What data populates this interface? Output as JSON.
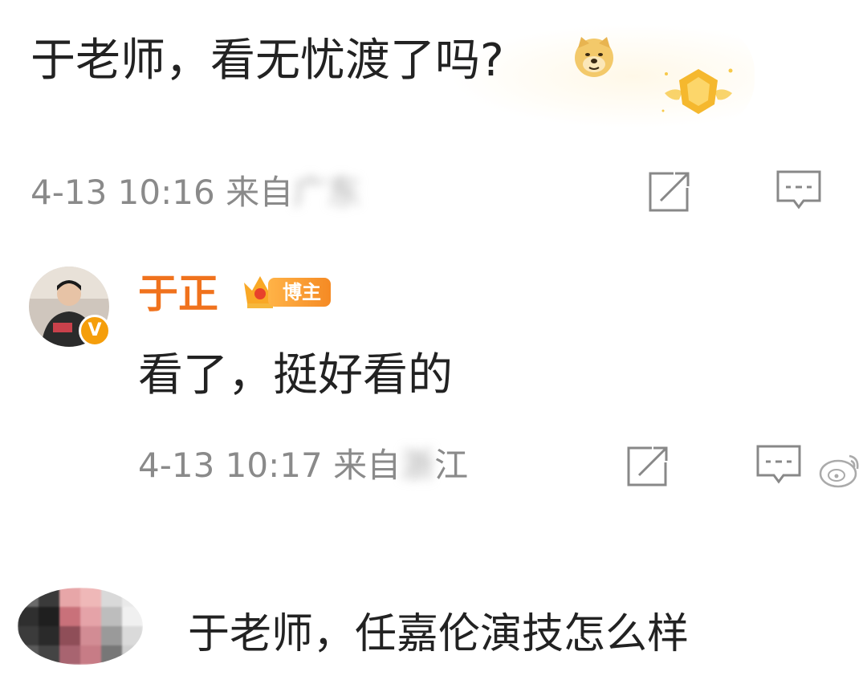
{
  "comment1": {
    "text": "于老师，看无忧渡了吗?",
    "emoji": "doge-emoji",
    "badge": "gold-fan-badge",
    "meta": {
      "time": "4-13 10:16",
      "from_label": "来自",
      "location_visible": "广",
      "location_blurred": "东"
    },
    "actions": [
      "share-icon",
      "comment-icon"
    ]
  },
  "comment2": {
    "author": "于正",
    "author_badge": "博主",
    "verified_badge": "V",
    "text": "看了，挺好看的",
    "meta": {
      "time": "4-13 10:17",
      "from_label": "来自",
      "location_blurred": "浙",
      "location_visible": "江"
    },
    "actions": [
      "share-icon",
      "comment-icon",
      "like-icon"
    ]
  },
  "comment3": {
    "text": "于老师，任嘉伦演技怎么样"
  },
  "colors": {
    "author_orange": "#f0721d",
    "meta_gray": "#8a8a8a",
    "text_dark": "#222222",
    "badge_orange": "#f59e0b"
  }
}
